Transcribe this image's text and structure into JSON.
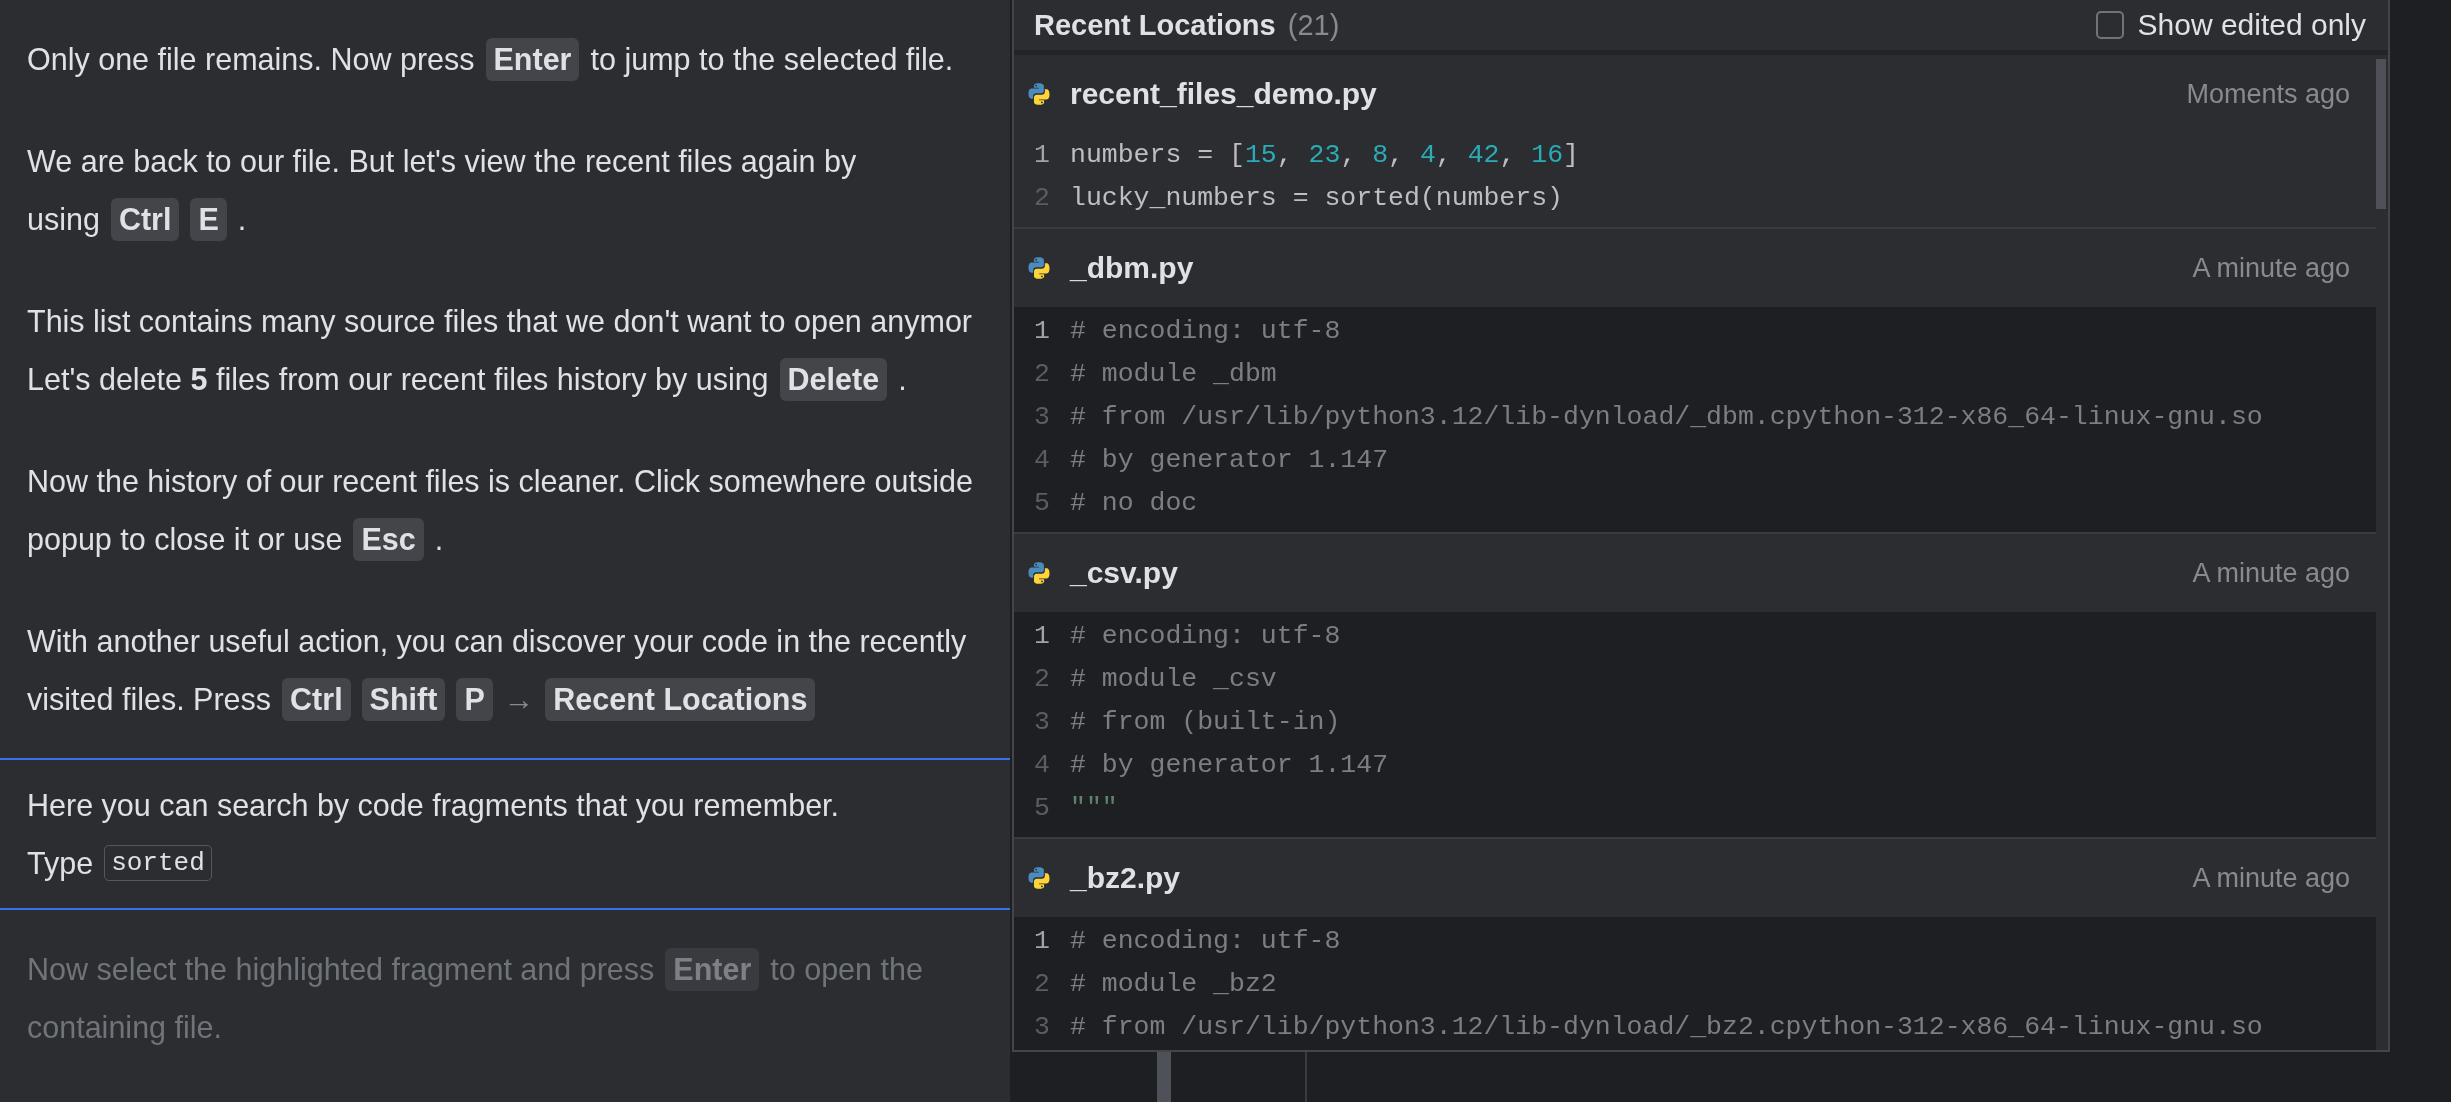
{
  "tutorial": {
    "steps": [
      {
        "selected": false,
        "disabled": false,
        "lines": [
          [
            {
              "kind": "text",
              "text": "Only one file remains. Now press"
            },
            {
              "kind": "key",
              "text": "Enter"
            },
            {
              "kind": "text",
              "text": "to jump to the selected file."
            }
          ]
        ]
      },
      {
        "selected": false,
        "disabled": false,
        "lines": [
          [
            {
              "kind": "text",
              "text": "We are back to our file. But let's view the recent files again by"
            }
          ],
          [
            {
              "kind": "text",
              "text": "using"
            },
            {
              "kind": "key",
              "text": "Ctrl"
            },
            {
              "kind": "key",
              "text": "E"
            },
            {
              "kind": "text",
              "text": "."
            }
          ]
        ]
      },
      {
        "selected": false,
        "disabled": false,
        "lines": [
          [
            {
              "kind": "text",
              "text": "This list contains many source files that we don't want to open anymor"
            }
          ],
          [
            {
              "kind": "text",
              "text": "Let's delete **5** files from our recent files history by using"
            },
            {
              "kind": "key",
              "text": "Delete"
            },
            {
              "kind": "text",
              "text": "."
            }
          ]
        ]
      },
      {
        "selected": false,
        "disabled": false,
        "lines": [
          [
            {
              "kind": "text",
              "text": "Now the history of our recent files is cleaner. Click somewhere outside"
            }
          ],
          [
            {
              "kind": "text",
              "text": "popup to close it or use"
            },
            {
              "kind": "key",
              "text": "Esc"
            },
            {
              "kind": "text",
              "text": "."
            }
          ]
        ]
      },
      {
        "selected": false,
        "disabled": false,
        "lines": [
          [
            {
              "kind": "text",
              "text": "With another useful action, you can discover your code in the recently"
            }
          ],
          [
            {
              "kind": "text",
              "text": "visited files. Press"
            },
            {
              "kind": "key",
              "text": "Ctrl"
            },
            {
              "kind": "key",
              "text": "Shift"
            },
            {
              "kind": "key",
              "text": "P"
            },
            {
              "kind": "arrow",
              "text": "→"
            },
            {
              "kind": "key",
              "text": "Recent Locations"
            }
          ]
        ]
      },
      {
        "selected": true,
        "disabled": false,
        "lines": [
          [
            {
              "kind": "text",
              "text": "Here you can search by code fragments that you remember."
            }
          ],
          [
            {
              "kind": "text",
              "text": "Type"
            },
            {
              "kind": "code",
              "text": "sorted"
            }
          ]
        ]
      },
      {
        "selected": false,
        "disabled": true,
        "lines": [
          [
            {
              "kind": "text",
              "text": "Now select the highlighted fragment and press"
            },
            {
              "kind": "key",
              "text": "Enter"
            },
            {
              "kind": "text",
              "text": "to open the"
            }
          ],
          [
            {
              "kind": "text",
              "text": "containing file."
            }
          ]
        ]
      }
    ]
  },
  "popup": {
    "title": "Recent Locations",
    "count": "(21)",
    "filter": {
      "label": "Show edited only",
      "checked": false
    },
    "entries": [
      {
        "file": "recent_files_demo.py",
        "time": "Moments ago",
        "selected": true,
        "lines": [
          {
            "number": "1",
            "current": true,
            "tokens": [
              {
                "kind": "plain",
                "text": "numbers = ["
              },
              {
                "kind": "number",
                "text": "15"
              },
              {
                "kind": "plain",
                "text": ", "
              },
              {
                "kind": "number",
                "text": "23"
              },
              {
                "kind": "plain",
                "text": ", "
              },
              {
                "kind": "number",
                "text": "8"
              },
              {
                "kind": "plain",
                "text": ", "
              },
              {
                "kind": "number",
                "text": "4"
              },
              {
                "kind": "plain",
                "text": ", "
              },
              {
                "kind": "number",
                "text": "42"
              },
              {
                "kind": "plain",
                "text": ", "
              },
              {
                "kind": "number",
                "text": "16"
              },
              {
                "kind": "plain",
                "text": "]"
              }
            ]
          },
          {
            "number": "2",
            "current": false,
            "tokens": [
              {
                "kind": "plain",
                "text": "lucky_numbers = sorted(numbers)"
              }
            ]
          }
        ]
      },
      {
        "file": "_dbm.py",
        "time": "A minute ago",
        "selected": false,
        "lines": [
          {
            "number": "1",
            "current": true,
            "tokens": [
              {
                "kind": "comment",
                "text": "# encoding: utf-8"
              }
            ]
          },
          {
            "number": "2",
            "current": false,
            "tokens": [
              {
                "kind": "comment",
                "text": "# module _dbm"
              }
            ]
          },
          {
            "number": "3",
            "current": false,
            "tokens": [
              {
                "kind": "comment",
                "text": "# from /usr/lib/python3.12/lib-dynload/_dbm.cpython-312-x86_64-linux-gnu.so"
              }
            ]
          },
          {
            "number": "4",
            "current": false,
            "tokens": [
              {
                "kind": "comment",
                "text": "# by generator 1.147"
              }
            ]
          },
          {
            "number": "5",
            "current": false,
            "tokens": [
              {
                "kind": "comment",
                "text": "# no doc"
              }
            ]
          }
        ]
      },
      {
        "file": "_csv.py",
        "time": "A minute ago",
        "selected": false,
        "lines": [
          {
            "number": "1",
            "current": true,
            "tokens": [
              {
                "kind": "comment",
                "text": "# encoding: utf-8"
              }
            ]
          },
          {
            "number": "2",
            "current": false,
            "tokens": [
              {
                "kind": "comment",
                "text": "# module _csv"
              }
            ]
          },
          {
            "number": "3",
            "current": false,
            "tokens": [
              {
                "kind": "comment",
                "text": "# from (built-in)"
              }
            ]
          },
          {
            "number": "4",
            "current": false,
            "tokens": [
              {
                "kind": "comment",
                "text": "# by generator 1.147"
              }
            ]
          },
          {
            "number": "5",
            "current": false,
            "tokens": [
              {
                "kind": "docstring",
                "text": "\"\"\""
              }
            ]
          }
        ]
      },
      {
        "file": "_bz2.py",
        "time": "A minute ago",
        "selected": false,
        "lines": [
          {
            "number": "1",
            "current": true,
            "tokens": [
              {
                "kind": "comment",
                "text": "# encoding: utf-8"
              }
            ]
          },
          {
            "number": "2",
            "current": false,
            "tokens": [
              {
                "kind": "comment",
                "text": "# module _bz2"
              }
            ]
          },
          {
            "number": "3",
            "current": false,
            "tokens": [
              {
                "kind": "comment",
                "text": "# from /usr/lib/python3.12/lib-dynload/_bz2.cpython-312-x86_64-linux-gnu.so"
              }
            ]
          }
        ]
      }
    ]
  }
}
